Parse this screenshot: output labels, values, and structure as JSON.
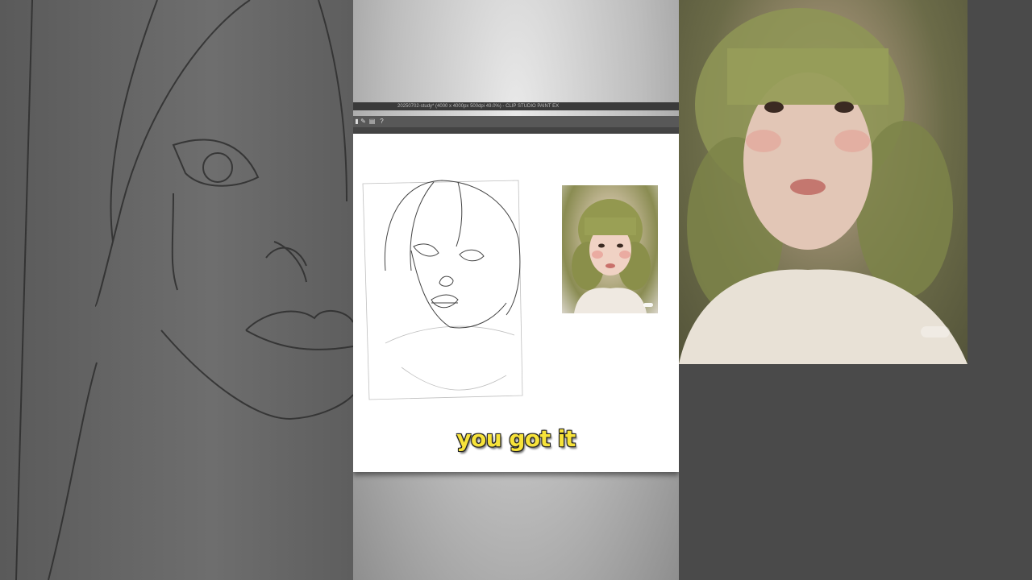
{
  "window": {
    "title": "20250702-study* (4000 x 4000px 500dpi 49.0%) - CLIP STUDIO PAINT EX"
  },
  "toolbar": {
    "icons": [
      "pen-icon",
      "brush-icon",
      "layer-icon",
      "help-icon"
    ]
  },
  "caption": {
    "text": "you got it"
  },
  "colors": {
    "caption_fill": "#f7e33a",
    "caption_outline": "#222222",
    "canvas": "#ffffff",
    "app_bar": "#3a3a3a"
  }
}
